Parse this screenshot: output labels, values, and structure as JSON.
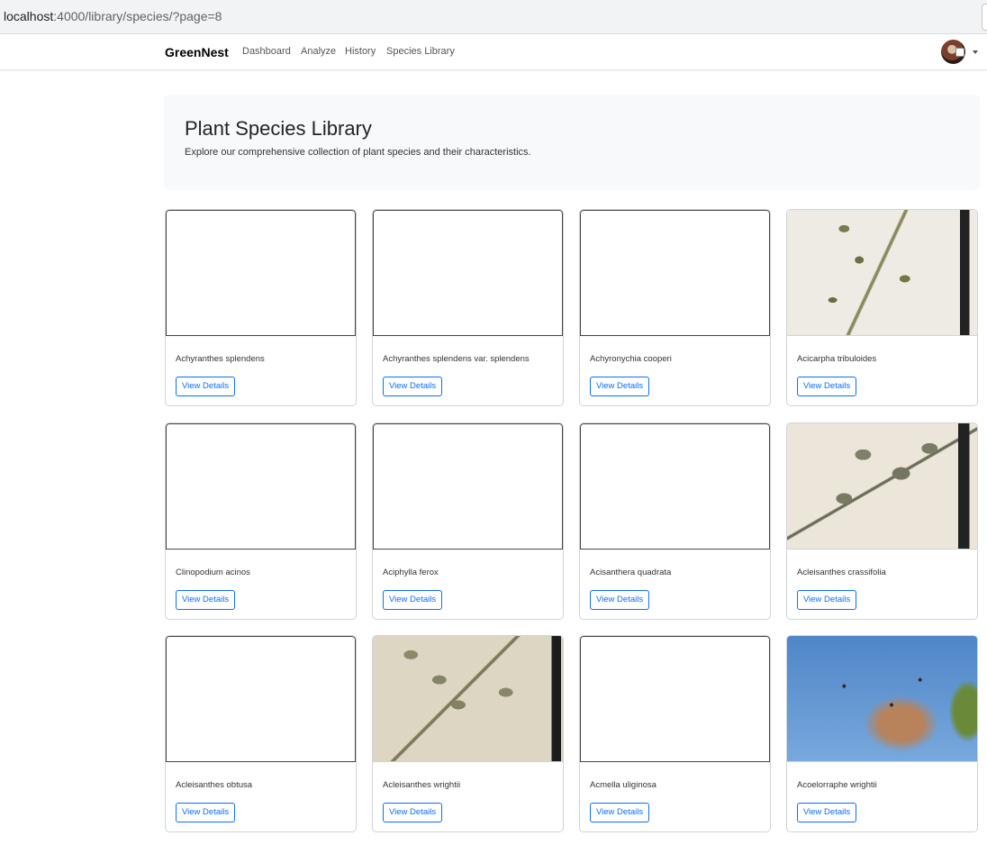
{
  "browser": {
    "url_host": "localhost",
    "url_rest": ":4000/library/species/?page=8"
  },
  "navbar": {
    "brand": "GreenNest",
    "links": [
      "Dashboard",
      "Analyze",
      "History",
      "Species Library"
    ]
  },
  "header": {
    "title": "Plant Species Library",
    "subtitle": "Explore our comprehensive collection of plant species and their characteristics."
  },
  "cards": [
    {
      "name": "Achyranthes splendens",
      "button": "View Details",
      "image": "none"
    },
    {
      "name": "Achyranthes splendens var. splendens",
      "button": "View Details",
      "image": "none"
    },
    {
      "name": "Achyronychia cooperi",
      "button": "View Details",
      "image": "none"
    },
    {
      "name": "Acicarpha tribuloides",
      "button": "View Details",
      "image": "herbarium-specimen"
    },
    {
      "name": "Clinopodium acinos",
      "button": "View Details",
      "image": "none"
    },
    {
      "name": "Aciphylla ferox",
      "button": "View Details",
      "image": "none"
    },
    {
      "name": "Acisanthera quadrata",
      "button": "View Details",
      "image": "none"
    },
    {
      "name": "Acleisanthes crassifolia",
      "button": "View Details",
      "image": "herbarium-specimen"
    },
    {
      "name": "Acleisanthes obtusa",
      "button": "View Details",
      "image": "none"
    },
    {
      "name": "Acleisanthes wrightii",
      "button": "View Details",
      "image": "herbarium-specimen"
    },
    {
      "name": "Acmella uliginosa",
      "button": "View Details",
      "image": "none"
    },
    {
      "name": "Acoelorraphe wrightii",
      "button": "View Details",
      "image": "palm-photo"
    }
  ],
  "colors": {
    "accent": "#0d6efd",
    "jumbotron_bg": "#f8f9fa"
  }
}
